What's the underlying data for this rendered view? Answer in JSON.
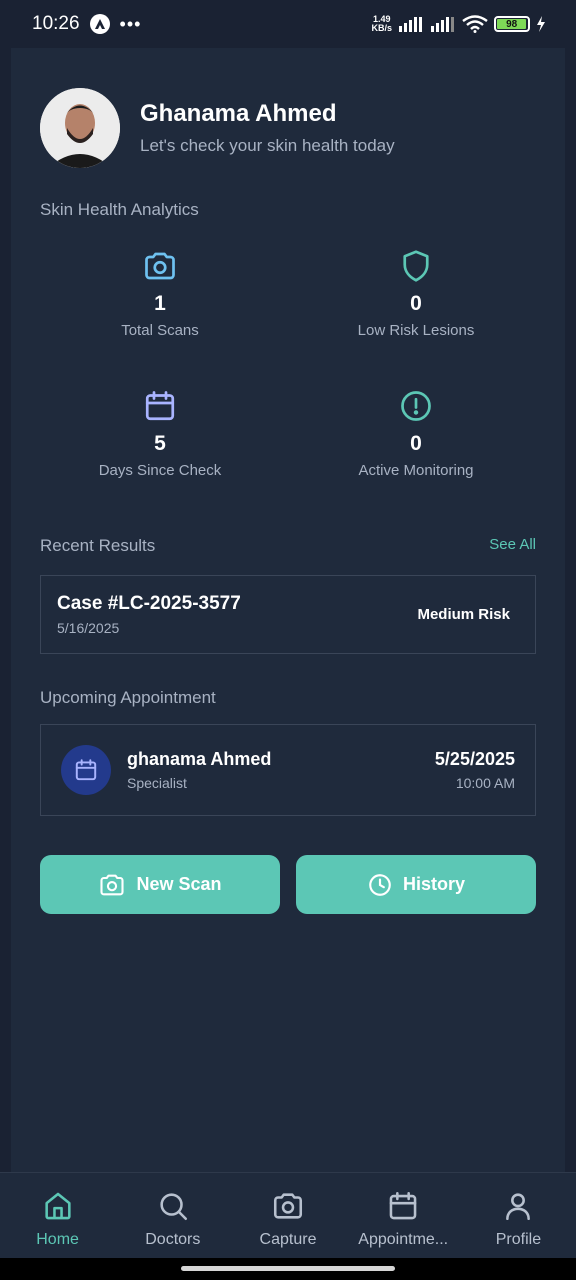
{
  "status_bar": {
    "time": "10:26",
    "net_speed_value": "1.49",
    "net_speed_unit": "KB/s",
    "battery": "98",
    "battery_level_percent": 98
  },
  "header": {
    "user_name": "Ghanama Ahmed",
    "subtitle": "Let's check your skin health today"
  },
  "analytics": {
    "title": "Skin Health Analytics",
    "stats": [
      {
        "value": "1",
        "label": "Total Scans",
        "icon": "camera-icon",
        "color": "#6ec1f0"
      },
      {
        "value": "0",
        "label": "Low Risk Lesions",
        "icon": "shield-icon",
        "color": "#5cc7b5"
      },
      {
        "value": "5",
        "label": "Days Since Check",
        "icon": "calendar-icon",
        "color": "#a9b4ff"
      },
      {
        "value": "0",
        "label": "Active Monitoring",
        "icon": "alert-circle-icon",
        "color": "#5cc7b5"
      }
    ]
  },
  "recent_results": {
    "title": "Recent Results",
    "see_all": "See All",
    "case_title": "Case #LC-2025-3577",
    "case_date": "5/16/2025",
    "risk": "Medium Risk"
  },
  "appointment": {
    "title": "Upcoming Appointment",
    "name": "ghanama Ahmed",
    "role": "Specialist",
    "date": "5/25/2025",
    "time": "10:00 AM"
  },
  "actions": {
    "new_scan": "New Scan",
    "history": "History"
  },
  "nav": {
    "items": [
      {
        "label": "Home",
        "icon": "home-icon"
      },
      {
        "label": "Doctors",
        "icon": "search-icon"
      },
      {
        "label": "Capture",
        "icon": "camera-icon"
      },
      {
        "label": "Appointme...",
        "icon": "calendar-icon"
      },
      {
        "label": "Profile",
        "icon": "user-icon"
      }
    ],
    "active": "Home"
  },
  "colors": {
    "accent": "#5cc7b5",
    "background": "#1a2233",
    "panel": "#1f2a3c",
    "muted_text": "#a8b2c3"
  }
}
